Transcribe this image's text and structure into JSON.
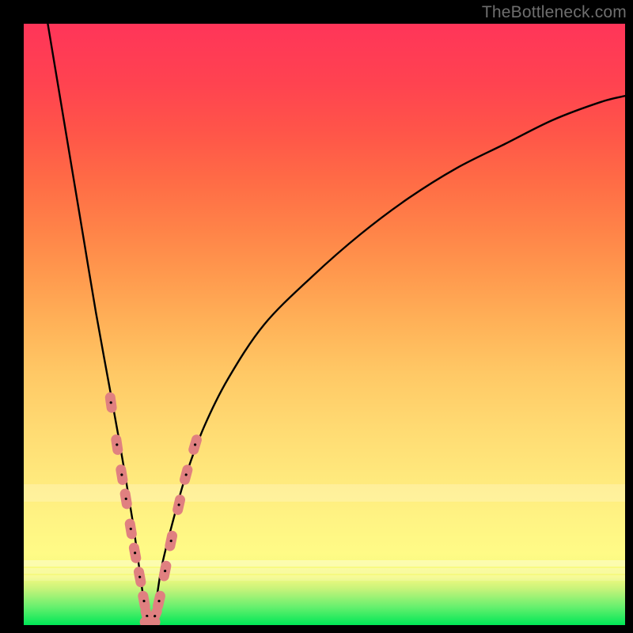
{
  "attribution": "TheBottleneck.com",
  "colors": {
    "frame_background": "#000000",
    "gradient_top": "#ff3559",
    "gradient_mid": "#ffd470",
    "gradient_bottom": "#00e756",
    "curve": "#000000",
    "marker_fill": "#e08080",
    "marker_stroke": "#bf5b5b"
  },
  "chart_data": {
    "type": "line",
    "title": "",
    "xlabel": "",
    "ylabel": "",
    "xlim": [
      0,
      100
    ],
    "ylim": [
      0,
      100
    ],
    "x_minimum_at": 21,
    "series": [
      {
        "name": "bottleneck-curve",
        "comment": "V-shaped curve; y≈0 at x≈21, rises steeply left to ~100 at x≈4, rises with diminishing slope right toward ~88 at x=100",
        "x": [
          4,
          6,
          8,
          10,
          12,
          14,
          16,
          18,
          19,
          20,
          21,
          22,
          23,
          25,
          27,
          30,
          34,
          40,
          48,
          56,
          64,
          72,
          80,
          88,
          96,
          100
        ],
        "y": [
          100,
          88,
          76,
          64,
          52,
          41,
          30,
          18,
          11,
          4,
          0,
          4,
          10,
          18,
          25,
          33,
          41,
          50,
          58,
          65,
          71,
          76,
          80,
          84,
          87,
          88
        ]
      }
    ],
    "markers": {
      "comment": "Salmon lozenge-shaped markers clustered on both flanks of the V near the bottom",
      "points": [
        {
          "x": 14.5,
          "y": 37
        },
        {
          "x": 15.5,
          "y": 30
        },
        {
          "x": 16.3,
          "y": 25
        },
        {
          "x": 17.0,
          "y": 21
        },
        {
          "x": 17.8,
          "y": 16
        },
        {
          "x": 18.5,
          "y": 12
        },
        {
          "x": 19.3,
          "y": 8
        },
        {
          "x": 20.0,
          "y": 4
        },
        {
          "x": 20.5,
          "y": 1.5
        },
        {
          "x": 21.0,
          "y": 0.5
        },
        {
          "x": 21.8,
          "y": 1.5
        },
        {
          "x": 22.5,
          "y": 4
        },
        {
          "x": 23.5,
          "y": 9
        },
        {
          "x": 24.5,
          "y": 14
        },
        {
          "x": 25.8,
          "y": 20
        },
        {
          "x": 27.0,
          "y": 25
        },
        {
          "x": 28.5,
          "y": 30
        }
      ]
    }
  }
}
